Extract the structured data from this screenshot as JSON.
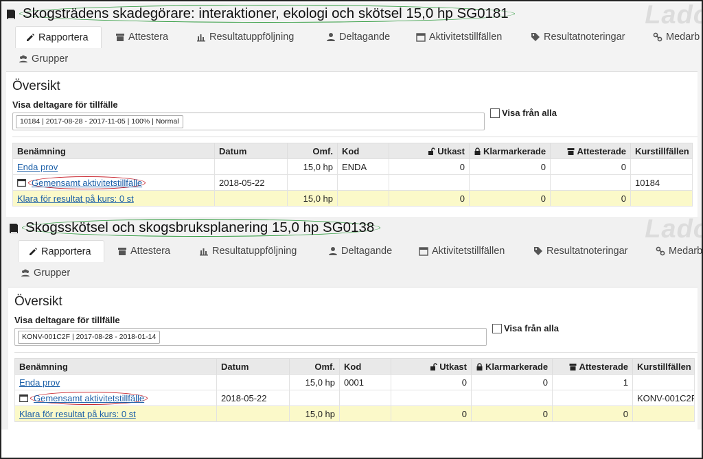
{
  "watermark": "Lado",
  "courses": [
    {
      "title": "Skogsträdens skadegörare: interaktioner, ekologi och skötsel 15,0 hp SG0181",
      "tabs": [
        "Rapportera",
        "Attestera",
        "Resultatuppföljning",
        "Deltagande",
        "Aktivitetstillfällen",
        "Resultatnoteringar",
        "Medarb"
      ],
      "tab_groups": "Grupper",
      "overview_heading": "Översikt",
      "participants_label": "Visa deltagare för tillfälle",
      "selected_occasion": "10184 | 2017-08-28 - 2017-11-05 | 100% | Normal",
      "show_all_label": "Visa från alla",
      "columns": [
        "Benämning",
        "Datum",
        "Omf.",
        "Kod",
        "Utkast",
        "Klarmarkerade",
        "Attesterade",
        "Kurstillfällen"
      ],
      "rows": [
        {
          "name": "Enda prov",
          "date": "",
          "scope": "15,0 hp",
          "code": "ENDA",
          "draft": "0",
          "marked": "0",
          "attested": "0",
          "occasion": ""
        },
        {
          "name": "Gemensamt aktivitetstillfälle",
          "date": "2018-05-22",
          "scope": "",
          "code": "",
          "draft": "",
          "marked": "",
          "attested": "",
          "occasion": "10184"
        }
      ],
      "summary": {
        "name": "Klara för resultat på kurs: 0 st",
        "scope": "15,0 hp",
        "draft": "0",
        "marked": "0",
        "attested": "0"
      }
    },
    {
      "title": "Skogsskötsel och skogsbruksplanering 15,0 hp SG0138",
      "tabs": [
        "Rapportera",
        "Attestera",
        "Resultatuppföljning",
        "Deltagande",
        "Aktivitetstillfällen",
        "Resultatnoteringar",
        "Medarbe"
      ],
      "tab_groups": "Grupper",
      "overview_heading": "Översikt",
      "participants_label": "Visa deltagare för tillfälle",
      "selected_occasion": "KONV-001C2F | 2017-08-28 - 2018-01-14",
      "show_all_label": "Visa från alla",
      "columns": [
        "Benämning",
        "Datum",
        "Omf.",
        "Kod",
        "Utkast",
        "Klarmarkerade",
        "Attesterade",
        "Kurstillfällen"
      ],
      "rows": [
        {
          "name": "Enda prov",
          "date": "",
          "scope": "15,0 hp",
          "code": "0001",
          "draft": "0",
          "marked": "0",
          "attested": "1",
          "occasion": ""
        },
        {
          "name": "Gemensamt aktivitetstillfälle",
          "date": "2018-05-22",
          "scope": "",
          "code": "",
          "draft": "",
          "marked": "",
          "attested": "",
          "occasion": "KONV-001C2F"
        }
      ],
      "summary": {
        "name": "Klara för resultat på kurs: 0 st",
        "scope": "15,0 hp",
        "draft": "0",
        "marked": "0",
        "attested": "0"
      }
    }
  ],
  "colors": {
    "highlight_title": "#2d9a3c",
    "highlight_link": "#c8232c",
    "link": "#1b5fa8",
    "summary_row": "#fbf9c9"
  }
}
